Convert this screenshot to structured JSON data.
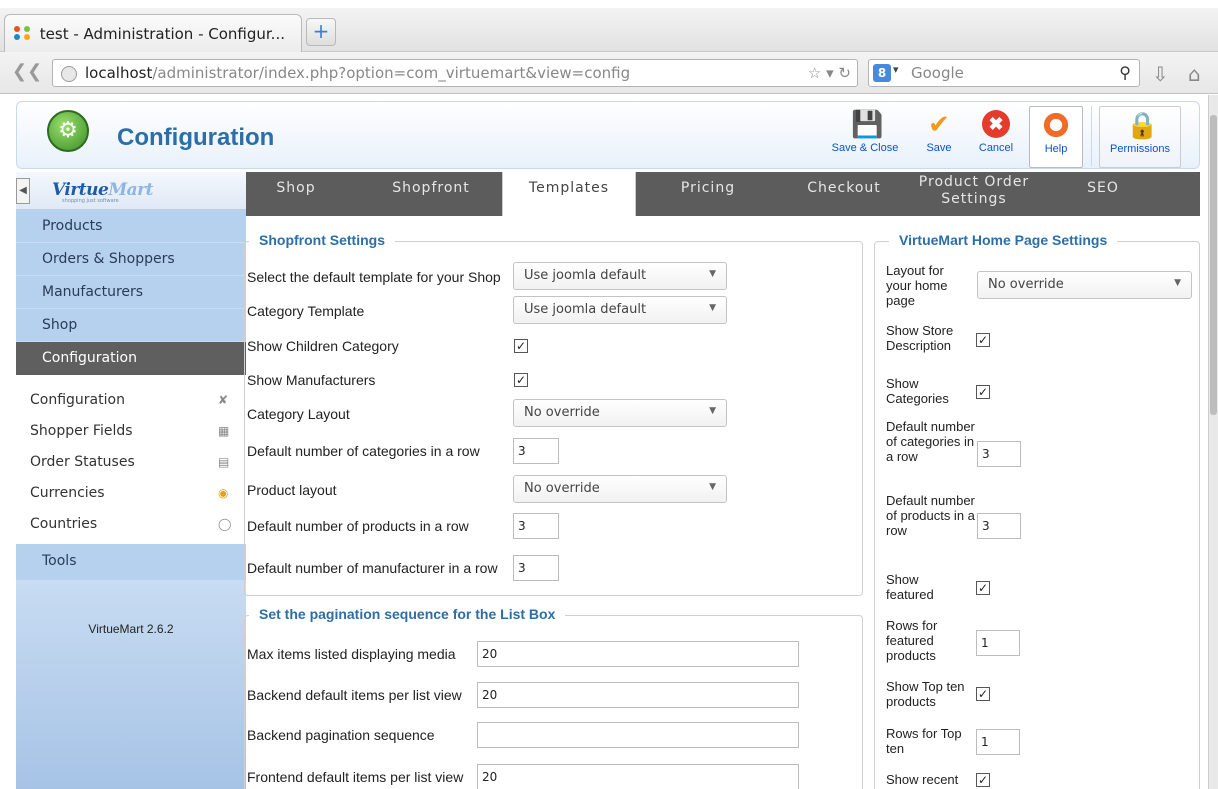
{
  "browser": {
    "tab_title": "test - Administration - Configur...",
    "new_tab_label": "+",
    "url_host": "localhost",
    "url_path": "/administrator/index.php?option=com_virtuemart&view=config",
    "search_engine": "8",
    "search_placeholder": "Google"
  },
  "header": {
    "title": "Configuration",
    "toolbar": {
      "save_close": "Save & Close",
      "save": "Save",
      "cancel": "Cancel",
      "help": "Help",
      "permissions": "Permissions"
    }
  },
  "sidebar": {
    "logo_virtue": "Virtue",
    "logo_mart": "Mart",
    "tagline": "shopping just software",
    "menu": [
      "Products",
      "Orders & Shoppers",
      "Manufacturers",
      "Shop",
      "Configuration"
    ],
    "submenu": [
      {
        "label": "Configuration",
        "icon": "tools-icon"
      },
      {
        "label": "Shopper Fields",
        "icon": "form-icon"
      },
      {
        "label": "Order Statuses",
        "icon": "document-icon"
      },
      {
        "label": "Currencies",
        "icon": "coins-icon"
      },
      {
        "label": "Countries",
        "icon": "globe-icon"
      }
    ],
    "tools": "Tools",
    "version": "VirtueMart 2.6.2"
  },
  "tabs": [
    "Shop",
    "Shopfront",
    "Templates",
    "Pricing",
    "Checkout",
    "Product Order Settings",
    "SEO"
  ],
  "active_tab": "Templates",
  "shopfront": {
    "legend": "Shopfront Settings",
    "default_template_label": "Select the default template for your Shop",
    "default_template_value": "Use joomla default",
    "category_template_label": "Category Template",
    "category_template_value": "Use joomla default",
    "show_children_label": "Show Children Category",
    "show_children": true,
    "show_manufacturers_label": "Show Manufacturers",
    "show_manufacturers": true,
    "category_layout_label": "Category Layout",
    "category_layout_value": "No override",
    "cat_per_row_label": "Default number of categories in a row",
    "cat_per_row_value": "3",
    "product_layout_label": "Product layout",
    "product_layout_value": "No override",
    "prod_per_row_label": "Default number of products in a row",
    "prod_per_row_value": "3",
    "manu_per_row_label": "Default number of manufacturer in a row",
    "manu_per_row_value": "3"
  },
  "pagination": {
    "legend": "Set the pagination sequence for the List Box",
    "max_media_label": "Max items listed displaying media",
    "max_media_value": "20",
    "backend_items_label": "Backend default items per list view",
    "backend_items_value": "20",
    "backend_seq_label": "Backend pagination sequence",
    "backend_seq_value": "",
    "frontend_items_label": "Frontend default items per list view",
    "frontend_items_value": "20"
  },
  "homepage": {
    "legend": "VirtueMart Home Page Settings",
    "layout_label": "Layout for your home page",
    "layout_value": "No override",
    "store_desc_label": "Show Store Description",
    "show_categories_label": "Show Categories",
    "cat_per_row_label": "Default number of categories in a row",
    "cat_per_row_value": "3",
    "prod_per_row_label": "Default number of products in a row",
    "prod_per_row_value": "3",
    "show_featured_label": "Show featured",
    "featured_rows_label": "Rows for featured products",
    "featured_rows_value": "1",
    "show_topten_label": "Show Top ten products",
    "topten_rows_label": "Rows for Top ten",
    "topten_rows_value": "1",
    "show_recent_label": "Show recent"
  }
}
